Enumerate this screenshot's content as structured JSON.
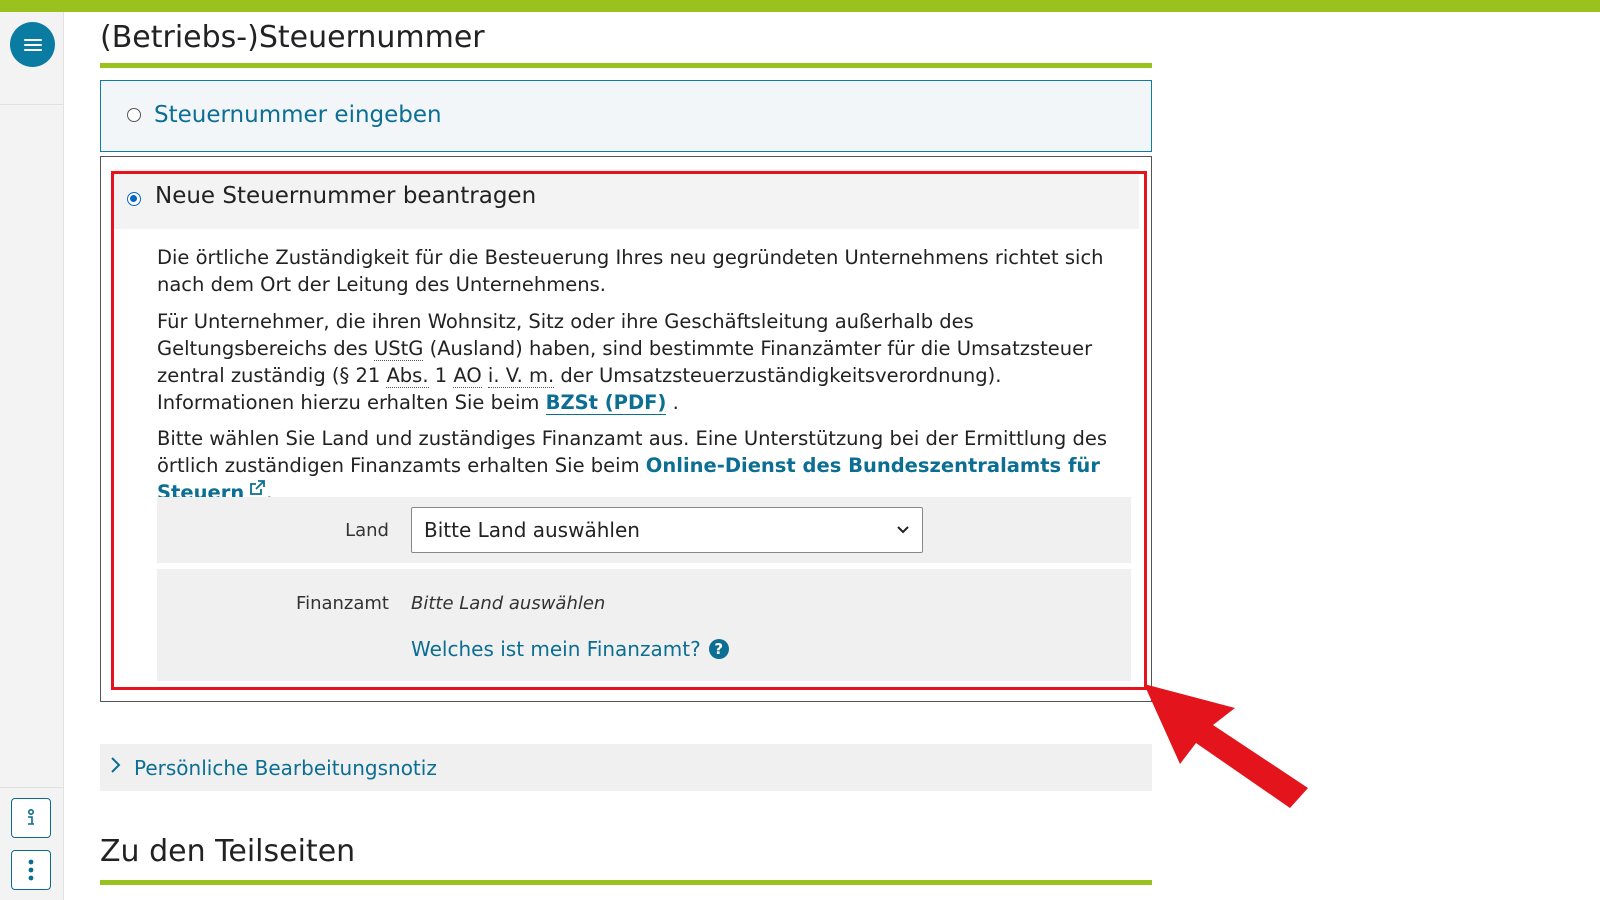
{
  "sidebar": {
    "menu_icon": "hamburger-icon",
    "info_icon": "person-info-icon",
    "more_icon": "vertical-dots-icon"
  },
  "section1": {
    "title": "(Betriebs-)Steuernummer"
  },
  "option_enter": {
    "label": "Steuernummer eingeben",
    "selected": false
  },
  "option_apply": {
    "label": "Neue Steuernummer beantragen",
    "selected": true,
    "para1": "Die örtliche Zuständigkeit für die Besteuerung Ihres neu gegründeten Unternehmens richtet sich nach dem Ort der Leitung des Unternehmens.",
    "para2": {
      "t1": "Für Unternehmer, die ihren Wohnsitz, Sitz oder ihre Geschäftsleitung außerhalb des Geltungsbereichs des ",
      "abbr1": "UStG",
      "t2": " (Ausland) haben, sind bestimmte Finanzämter für die Umsatzsteuer zentral zuständig (§ 21 ",
      "abbr2": "Abs.",
      "t3": " 1 ",
      "abbr3": "AO",
      "t4": " ",
      "abbr4": "i. V. m.",
      "t5": " der Umsatzsteuerzuständigkeitsverordnung). Informationen hierzu erhalten Sie beim ",
      "link": "BZSt (PDF)",
      "t6": " ."
    },
    "para3": {
      "t1": "Bitte wählen Sie Land und zuständiges Finanzamt aus. Eine Unterstützung bei der Ermittlung des örtlich zuständigen Finanzamts erhalten Sie beim ",
      "link": "Online-Dienst des Bundeszentralamts für Steuern",
      "t2": "."
    },
    "land_label": "Land",
    "land_value": "Bitte Land auswählen",
    "finanzamt_label": "Finanzamt",
    "finanzamt_value": "Bitte Land auswählen",
    "help_link": "Welches ist mein Finanzamt?"
  },
  "notes": {
    "label": "Persönliche Bearbeitungsnotiz"
  },
  "section2": {
    "title": "Zu den Teilseiten"
  },
  "colors": {
    "accent_green": "#9ac21f",
    "link_blue": "#0b6e92",
    "highlight_red": "#e3141b"
  }
}
